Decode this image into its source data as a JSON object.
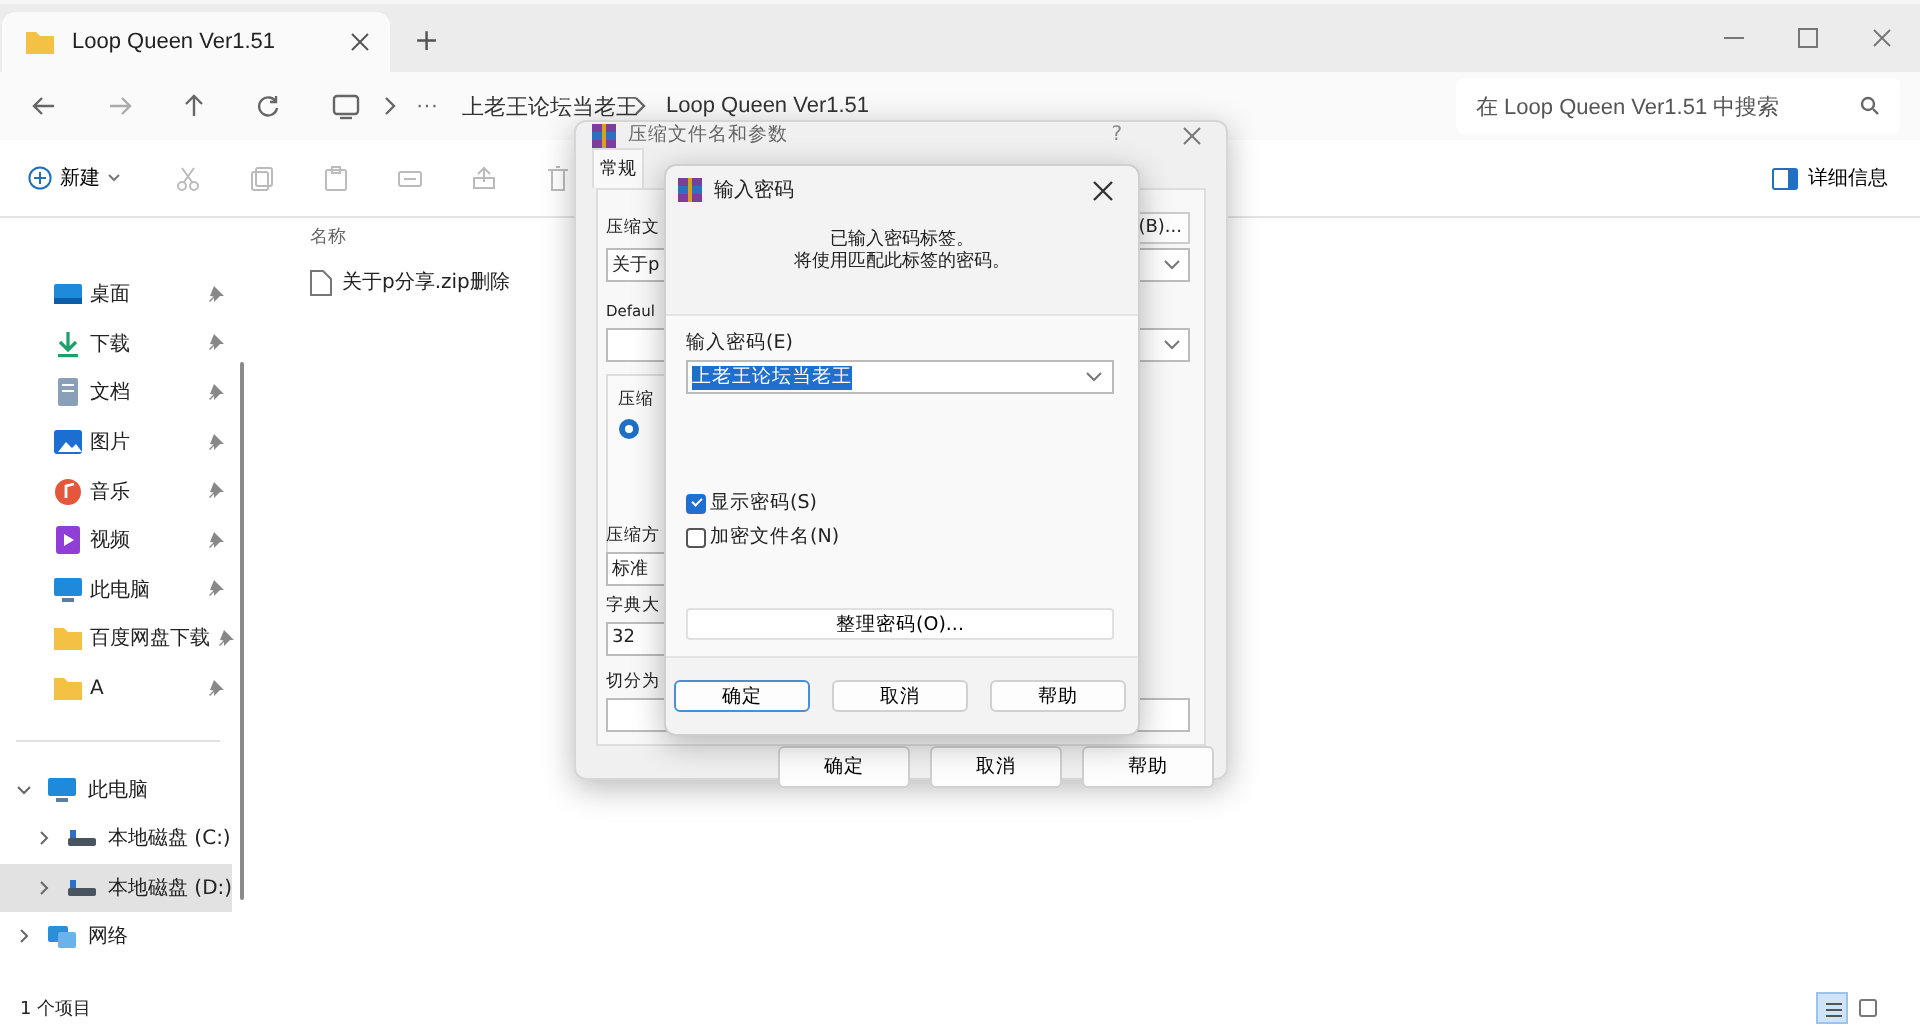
{
  "window": {
    "tab_title": "Loop Queen Ver1.51",
    "new_tab": "+"
  },
  "address": {
    "overflow": "···",
    "breadcrumbs": [
      "上老王论坛当老王",
      "Loop Queen Ver1.51"
    ]
  },
  "search": {
    "placeholder": "在 Loop Queen Ver1.51 中搜索"
  },
  "toolbar": {
    "new_label": "新建",
    "details_label": "详细信息"
  },
  "sidebar": {
    "quick_access": [
      {
        "label": "桌面",
        "kind": "desktop"
      },
      {
        "label": "下载",
        "kind": "download"
      },
      {
        "label": "文档",
        "kind": "documents"
      },
      {
        "label": "图片",
        "kind": "pictures"
      },
      {
        "label": "音乐",
        "kind": "music"
      },
      {
        "label": "视频",
        "kind": "videos"
      },
      {
        "label": "此电脑",
        "kind": "pc"
      },
      {
        "label": "百度网盘下载",
        "kind": "folder"
      },
      {
        "label": "A",
        "kind": "folder"
      }
    ],
    "tree": [
      {
        "label": "此电脑",
        "kind": "pc",
        "expanded": true,
        "selected": false,
        "children": [
          {
            "label": "本地磁盘 (C:)",
            "kind": "drive",
            "expanded": false,
            "selected": false
          },
          {
            "label": "本地磁盘 (D:)",
            "kind": "drive",
            "expanded": false,
            "selected": true
          }
        ]
      },
      {
        "label": "网络",
        "kind": "network",
        "expanded": false,
        "selected": false
      }
    ]
  },
  "file_list": {
    "columns": [
      "名称"
    ],
    "files": [
      {
        "name": "关于p分享.zip删除"
      }
    ]
  },
  "status_bar": {
    "item_count": "1 个项目",
    "views": [
      {
        "kind": "details",
        "selected": true
      },
      {
        "kind": "tiles",
        "selected": false
      }
    ]
  },
  "archive_dialog": {
    "title": "压缩文件名和参数",
    "help": "?",
    "tabs": [
      {
        "label": "常规",
        "selected": true
      }
    ],
    "archive_name_label": "压缩文",
    "archive_name_value": "关于p",
    "browse_button": "(B)...",
    "profile_label": "Defaul",
    "group_label": "压缩",
    "method_label": "压缩方",
    "method_value": "标准",
    "dictionary_label": "字典大",
    "dictionary_value": "32",
    "split_label": "切分为",
    "buttons": [
      "确定",
      "取消",
      "帮助"
    ]
  },
  "password_dialog": {
    "title": "输入密码",
    "message": [
      "已输入密码标签。",
      "将使用匹配此标签的密码。"
    ],
    "field_label": "输入密码(E)",
    "value": "上老王论坛当老王",
    "options": [
      {
        "label": "显示密码(S)",
        "checked": true
      },
      {
        "label": "加密文件名(N)",
        "checked": false
      }
    ],
    "organize_button": "整理密码(O)...",
    "buttons": [
      "确定",
      "取消",
      "帮助"
    ]
  }
}
